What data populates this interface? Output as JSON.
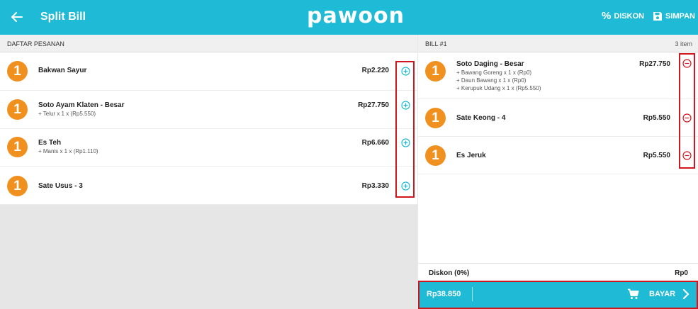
{
  "header": {
    "title": "Split Bill",
    "logo": "pawoon",
    "diskon_label": "DISKON",
    "simpan_label": "SIMPAN",
    "pct_symbol": "%"
  },
  "left": {
    "section_title": "DAFTAR PESANAN",
    "items": [
      {
        "qty": "1",
        "name": "Bakwan Sayur",
        "modifiers": [],
        "price": "Rp2.220"
      },
      {
        "qty": "1",
        "name": "Soto Ayam Klaten - Besar",
        "modifiers": [
          "+ Telur x 1 x (Rp5.550)"
        ],
        "price": "Rp27.750"
      },
      {
        "qty": "1",
        "name": "Es Teh",
        "modifiers": [
          "+ Manis x 1 x (Rp1.110)"
        ],
        "price": "Rp6.660"
      },
      {
        "qty": "1",
        "name": "Sate Usus - 3",
        "modifiers": [],
        "price": "Rp3.330"
      }
    ]
  },
  "bill": {
    "title": "BILL #1",
    "count": "3 item",
    "items": [
      {
        "qty": "1",
        "name": "Soto Daging - Besar",
        "modifiers": [
          "+ Bawang Goreng x 1 x (Rp0)",
          "+ Daun Bawang x 1 x (Rp0)",
          "+ Kerupuk Udang x 1 x (Rp5.550)"
        ],
        "price": "Rp27.750"
      },
      {
        "qty": "1",
        "name": "Sate Keong - 4",
        "modifiers": [],
        "price": "Rp5.550"
      },
      {
        "qty": "1",
        "name": "Es Jeruk",
        "modifiers": [],
        "price": "Rp5.550"
      }
    ],
    "diskon_label": "Diskon (0%)",
    "diskon_value": "Rp0",
    "total": "Rp38.850",
    "pay_label": "BAYAR"
  },
  "colors": {
    "primary": "#1fbad6",
    "badge": "#f0901e",
    "add_icon": "#1fbad6",
    "remove_icon": "#d0161e",
    "highlight": "#d0161e"
  },
  "icons": {
    "back": "arrow-left-icon",
    "discount": "percent-icon",
    "save": "floppy-disk-icon",
    "add": "plus-circle-icon",
    "remove": "minus-circle-icon",
    "cart": "cart-icon",
    "next": "chevron-right-icon"
  }
}
